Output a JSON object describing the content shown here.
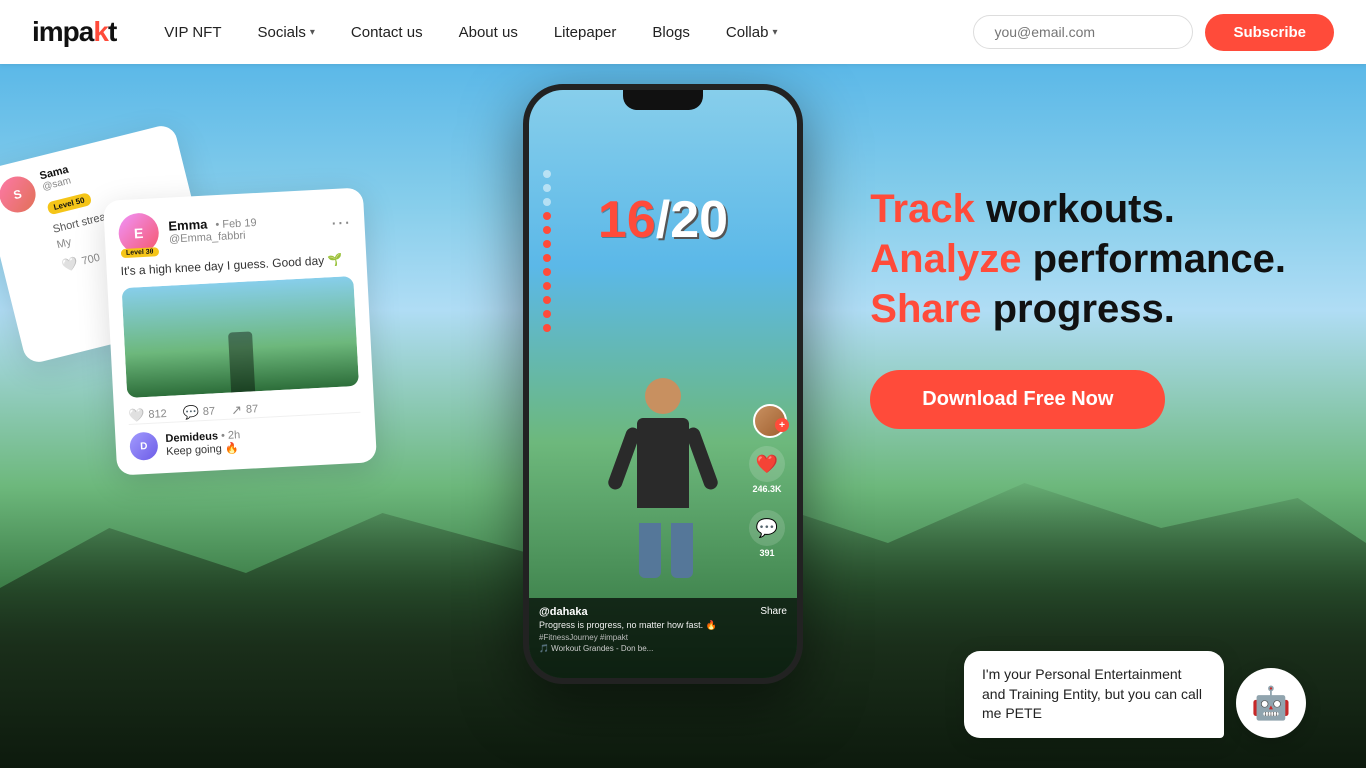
{
  "brand": {
    "name_part1": "impa",
    "name_part2": "k",
    "name_part3": "t"
  },
  "navbar": {
    "links": [
      {
        "label": "VIP NFT",
        "has_dropdown": false
      },
      {
        "label": "Socials",
        "has_dropdown": true
      },
      {
        "label": "Contact us",
        "has_dropdown": false
      },
      {
        "label": "About us",
        "has_dropdown": false
      },
      {
        "label": "Litepaper",
        "has_dropdown": false
      },
      {
        "label": "Blogs",
        "has_dropdown": false
      },
      {
        "label": "Collab",
        "has_dropdown": true
      }
    ],
    "email_placeholder": "you@email.com",
    "subscribe_label": "Subscribe"
  },
  "hero": {
    "headline_line1_highlight": "Track",
    "headline_line1_rest": " workouts.",
    "headline_line2_highlight": "Analyze",
    "headline_line2_rest": " performance.",
    "headline_line3_highlight": "Share",
    "headline_line3_rest": " progress.",
    "cta_label": "Download Free Now"
  },
  "phone": {
    "counter": "16",
    "counter_total": "/20",
    "username": "@dahaka",
    "caption": "Progress is progress, no matter how fast. 🔥",
    "hashtags": "#FitnessJourney #impakt",
    "music": "🎵 Workout Grandes - Don be...",
    "share_label": "Share",
    "likes": "246.3K",
    "comments": "391",
    "profile_add": "+",
    "dots_count": 12,
    "active_dots": [
      5,
      6,
      7,
      8,
      9,
      10,
      11
    ]
  },
  "cards": [
    {
      "username": "Emma",
      "date": "• Feb 19",
      "handle": "@Emma_fabbri",
      "level": "Level 3θ",
      "text": "It's a high knee day I guess. Good day 🌱",
      "likes": "812",
      "comments": "87",
      "shares": "87",
      "commenter_name": "Demideus",
      "commenter_time": "• 2h",
      "comment_text": "Keep going 🔥"
    },
    {
      "username": "Sama",
      "handle": "@sam",
      "level": "Level 50",
      "text": "My",
      "likes": "700"
    }
  ],
  "pete": {
    "bubble_text": "I'm your Personal Entertainment and Training Entity, but you can call me PETE",
    "avatar_icon": "🤖"
  },
  "colors": {
    "accent": "#ff4b3a",
    "dark": "#111111",
    "white": "#ffffff"
  }
}
